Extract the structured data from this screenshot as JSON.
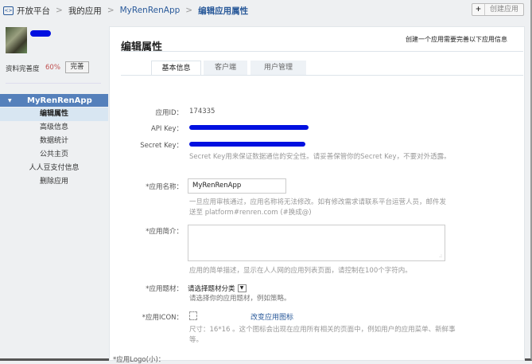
{
  "breadcrumb": {
    "items": [
      "开放平台",
      "我的应用",
      "MyRenRenApp"
    ],
    "current": "编辑应用属性"
  },
  "header": {
    "create_button": "创建应用",
    "plus": "+"
  },
  "profile": {
    "completeness_label": "资料完善度",
    "completeness_value": "60%",
    "complete_button": "完善"
  },
  "sidebar": {
    "app_name": "MyRenRenApp",
    "items": [
      "编辑属性",
      "高级信息",
      "数据统计",
      "公共主页",
      "人人豆支付信息",
      "删除应用"
    ]
  },
  "main": {
    "title": "编辑属性",
    "note": "创建一个应用需要完善以下应用信息",
    "tabs": [
      "基本信息",
      "客户端",
      "用户管理"
    ],
    "form": {
      "app_id_label": "应用ID：",
      "app_id": "174335",
      "api_key_label": "API Key：",
      "secret_key_label": "Secret Key：",
      "secret_hint": "Secret Key用来保证数据通信的安全性。请妥善保管你的Secret Key，不要对外透露。",
      "name_label": "*应用名称：",
      "name_value": "MyRenRenApp",
      "name_hint": "一旦应用审核通过，应用名称将无法修改。如有修改需求请联系平台运营人员，邮件发送至 platform#renren.com (#换成@)",
      "desc_label": "*应用简介：",
      "desc_hint": "应用的简单描述，显示在人人网的应用列表页面，请控制在100个字符内。",
      "category_label": "*应用题材：",
      "category_value": "请选择题材分类",
      "category_hint": "请选择你的应用题材，例如策略。",
      "icon_label": "*应用ICON：",
      "icon_link": "改变应用图标",
      "icon_hint": "尺寸：16*16 。这个图标会出现在应用所有相关的页面中，例如用户的应用菜单、新鲜事等。",
      "logo_label": "*应用Logo(小)："
    }
  }
}
